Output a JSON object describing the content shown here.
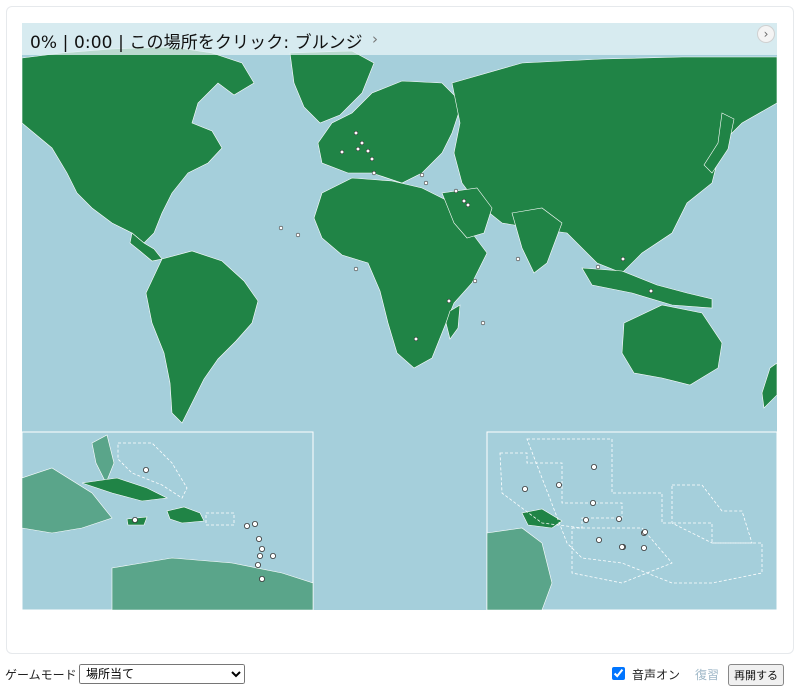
{
  "status": {
    "text": "0% | 0:00 | この場所をクリック: ブルンジ",
    "inline_icon": "chevron-right-icon",
    "corner_icon": "chevron-right-icon"
  },
  "colors": {
    "ocean": "#a5cfdb",
    "land": "#208446",
    "land_faded": "#5aa58a",
    "borders": "#ffffff",
    "marker_fill": "#ffffff",
    "marker_stroke": "#333333"
  },
  "map": {
    "target_country": "ブルンジ",
    "insets": [
      "caribbean",
      "pacific-islands"
    ]
  },
  "toolbar": {
    "mode_label": "ゲームモード",
    "mode_selected": "場所当て",
    "sound_label": "音声オン",
    "sound_checked": true,
    "review_label": "復習",
    "restart_label": "再開する"
  }
}
